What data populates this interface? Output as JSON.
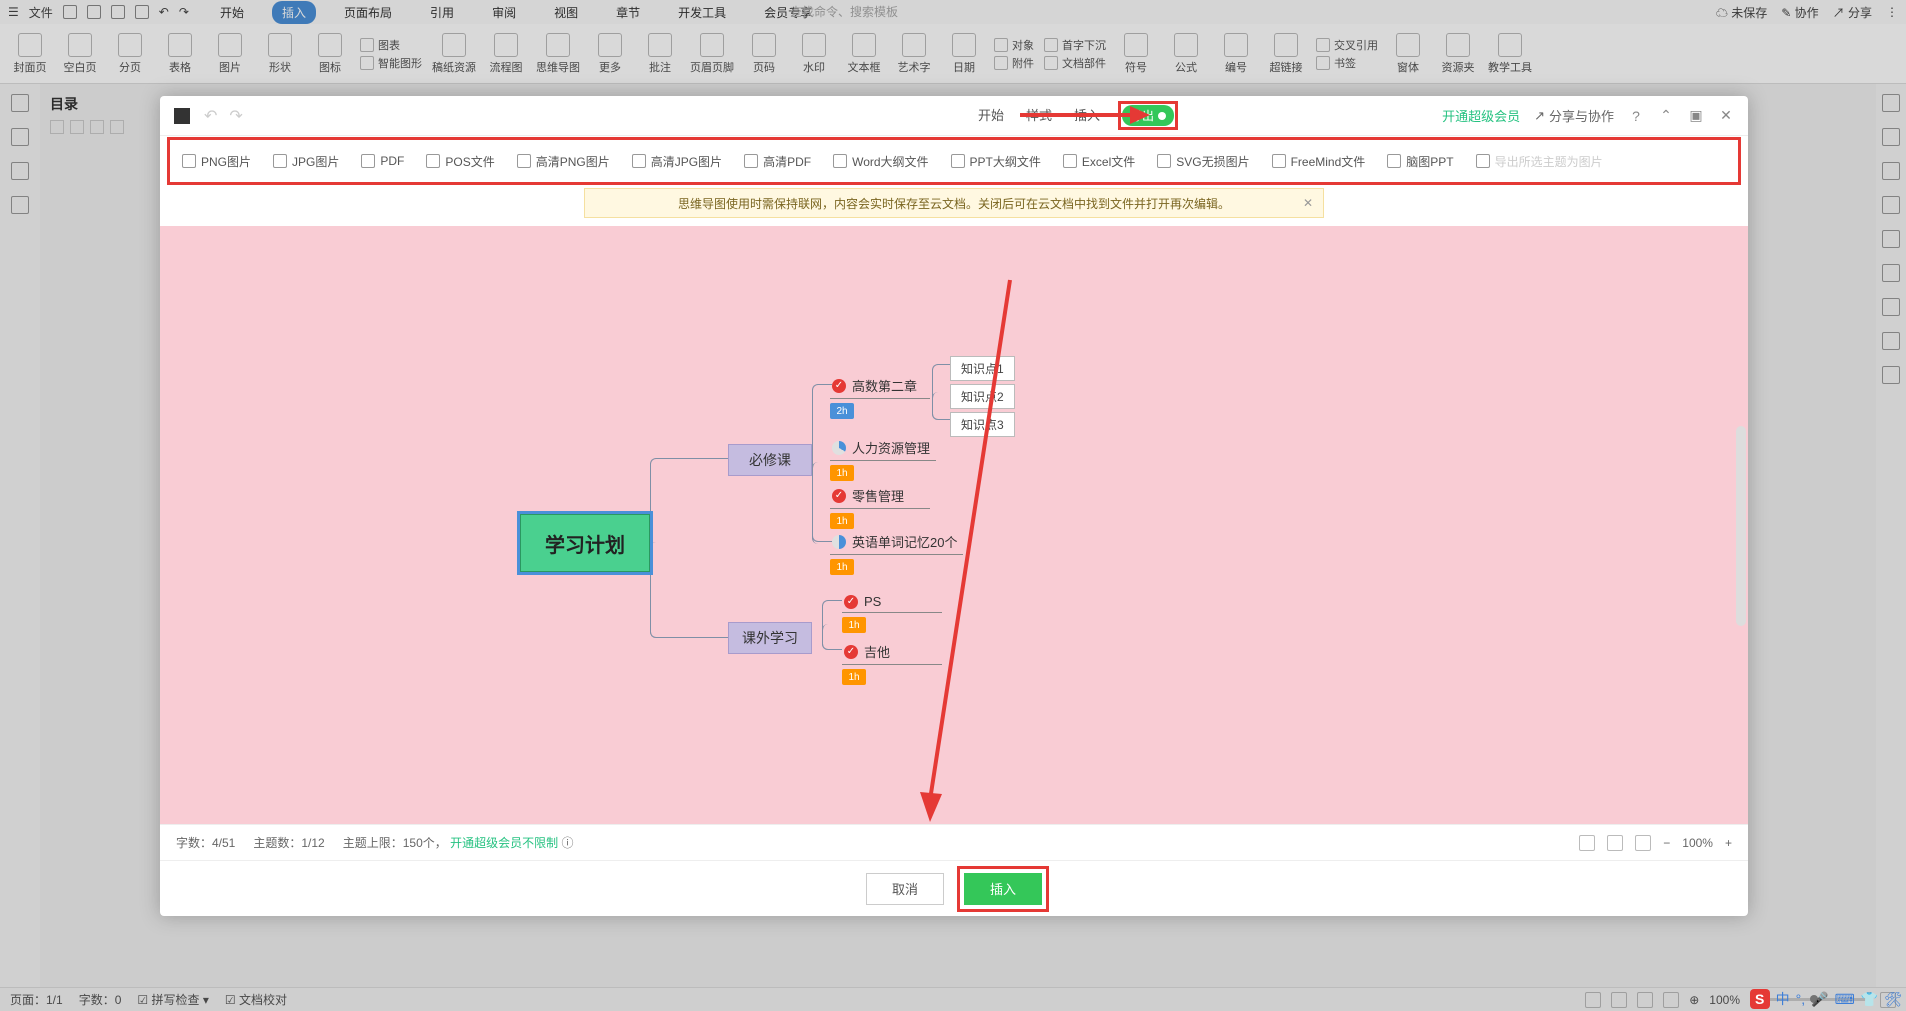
{
  "top": {
    "file": "文件",
    "unsaved": "未保存",
    "collab": "协作",
    "share": "分享",
    "search_ph": "查找命令、搜索模板"
  },
  "ribbon_tabs": [
    "开始",
    "插入",
    "页面布局",
    "引用",
    "审阅",
    "视图",
    "章节",
    "开发工具",
    "会员专享"
  ],
  "ribbon_groups": [
    "封面页",
    "空白页",
    "分页",
    "表格",
    "图片",
    "形状",
    "图标",
    "智能图形",
    "稿纸资源",
    "流程图",
    "思维导图",
    "更多",
    "批注",
    "页眉页脚",
    "页码",
    "水印",
    "文本框",
    "艺术字",
    "日期",
    "附件",
    "文档部件",
    "符号",
    "公式",
    "编号",
    "超链接",
    "书签",
    "交叉引用",
    "窗体",
    "资源夹",
    "教学工具"
  ],
  "ribbon_sm": {
    "chart": "图表",
    "shoucixj": "首字下沉",
    "obj": "对象"
  },
  "toc": {
    "title": "目录"
  },
  "dialog": {
    "tabs": [
      "开始",
      "样式",
      "插入"
    ],
    "export": "导出",
    "vip": "开通超级会员",
    "share": "分享与协作"
  },
  "export_items": [
    "PNG图片",
    "JPG图片",
    "PDF",
    "POS文件",
    "高清PNG图片",
    "高清JPG图片",
    "高清PDF",
    "Word大纲文件",
    "PPT大纲文件",
    "Excel文件",
    "SVG无损图片",
    "FreeMind文件",
    "脑图PPT",
    "导出所选主题为图片"
  ],
  "notice": "思维导图使用时需保持联网，内容会实时保存至云文档。关闭后可在云文档中找到文件并打开再次编辑。",
  "mindmap": {
    "root": "学习计划",
    "branch1": "必修课",
    "branch2": "课外学习",
    "n1": "高数第二章",
    "d1": "2h",
    "n2": "人力资源管理",
    "d2": "1h",
    "n3": "零售管理",
    "d3": "1h",
    "n4": "英语单词记忆20个",
    "d4": "1h",
    "n5": "PS",
    "d5": "1h",
    "n6": "吉他",
    "d6": "1h",
    "k1": "知识点1",
    "k2": "知识点2",
    "k3": "知识点3"
  },
  "dlg_status": {
    "chars": "字数：4/51",
    "topics": "主题数：1/12",
    "limit": "主题上限：150个，",
    "vip": "开通超级会员不限制",
    "zoom": "100%"
  },
  "buttons": {
    "cancel": "取消",
    "insert": "插入"
  },
  "statusbar": {
    "page": "页面：1/1",
    "words": "字数：0",
    "spell": "拼写检查",
    "doccheck": "文档校对",
    "zoom": "100%"
  },
  "ime": {
    "s": "S",
    "cn": "中"
  }
}
